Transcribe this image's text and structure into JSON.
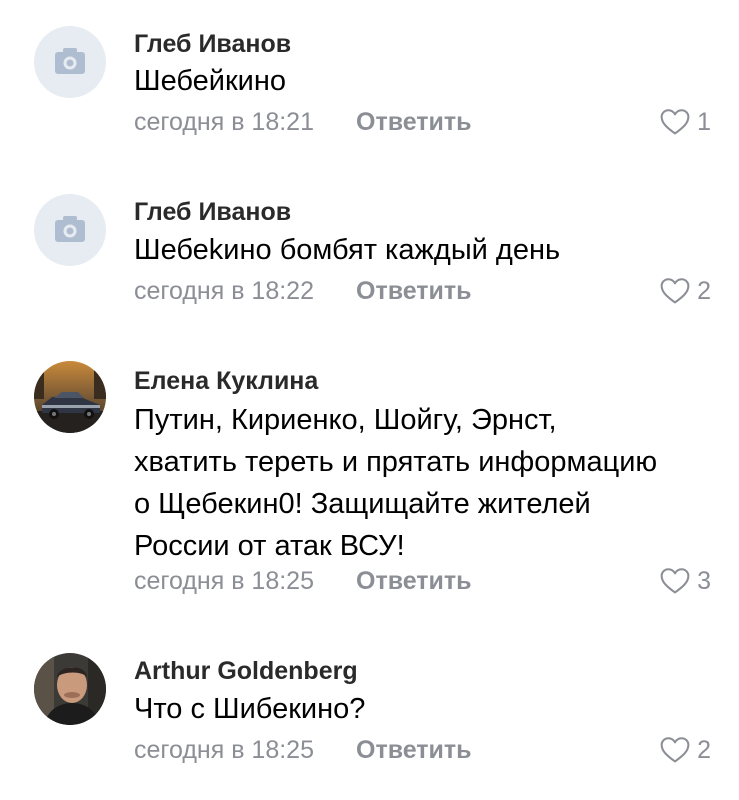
{
  "comments": [
    {
      "author": "Глеб Иванов",
      "text": "Шебейкино",
      "time": "сегодня в 18:21",
      "reply_label": "Ответить",
      "likes": "1",
      "avatar": "camera-placeholder-icon"
    },
    {
      "author": "Глеб Иванов",
      "text": "Шебеkино бомбят каждый день",
      "time": "сегодня в 18:22",
      "reply_label": "Ответить",
      "likes": "2",
      "avatar": "camera-placeholder-icon"
    },
    {
      "author": "Елена Куклина",
      "text": "Путин, Кириенко, Шойгу, Эрнст,\nхватить тереть и прятать информацию\nо Щебекин0! Защищайте жителей\nРоссии от атак ВСУ!",
      "time": "сегодня в 18:25",
      "reply_label": "Ответить",
      "likes": "3",
      "avatar": "car-photo"
    },
    {
      "author": "Arthur Goldenberg",
      "text": "Что с Шибекино?",
      "time": "сегодня в 18:25",
      "reply_label": "Ответить",
      "likes": "2",
      "avatar": "person-photo"
    }
  ],
  "colors": {
    "meta_gray": "#8b8e94",
    "placeholder_bg": "#e7ecf2",
    "placeholder_icon": "#aebdd0"
  }
}
